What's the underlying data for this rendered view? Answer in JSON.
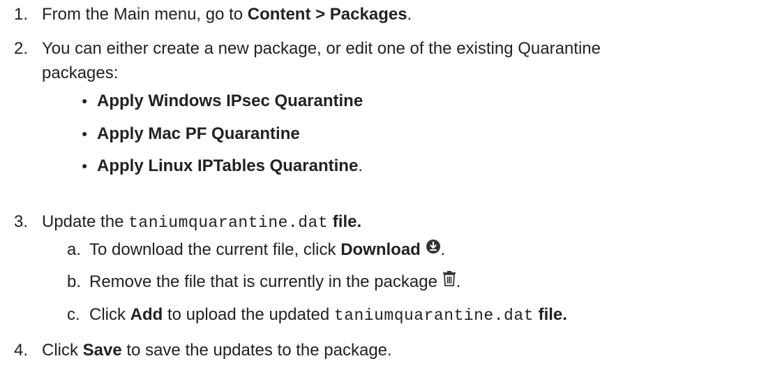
{
  "steps": [
    {
      "num": "1.",
      "text_before": "From the Main menu, go to ",
      "bold": "Content > Packages",
      "text_after": "."
    },
    {
      "num": "2.",
      "line1": "You can either create a new package, or edit one of the existing Quarantine",
      "line2": "packages:",
      "bullets": [
        {
          "bold": "Apply Windows IPsec Quarantine",
          "after": ""
        },
        {
          "bold": "Apply Mac PF Quarantine",
          "after": ""
        },
        {
          "bold": "Apply Linux IPTables Quarantine",
          "after": "."
        }
      ]
    },
    {
      "num": "3.",
      "text_before": "Update the ",
      "code": "taniumquarantine.dat",
      "text_after": " file.",
      "substeps": [
        {
          "letter": "a.",
          "text_before": "To download the current file, click ",
          "bold": "Download",
          "text_after": ".",
          "icon": "download-circle-icon"
        },
        {
          "letter": "b.",
          "text": "Remove the file that is currently in the package ",
          "text_after": ".",
          "icon": "trash-icon"
        },
        {
          "letter": "c.",
          "text_before": "Click ",
          "bold": "Add",
          "text_mid": " to upload the updated ",
          "code": "taniumquarantine.dat",
          "text_after": " file."
        }
      ]
    },
    {
      "num": "4.",
      "text_before": "Click ",
      "bold": "Save",
      "text_after": " to save the updates to the package."
    }
  ],
  "colors": {
    "text": "#222222",
    "icon": "#333333",
    "background": "#ffffff"
  }
}
